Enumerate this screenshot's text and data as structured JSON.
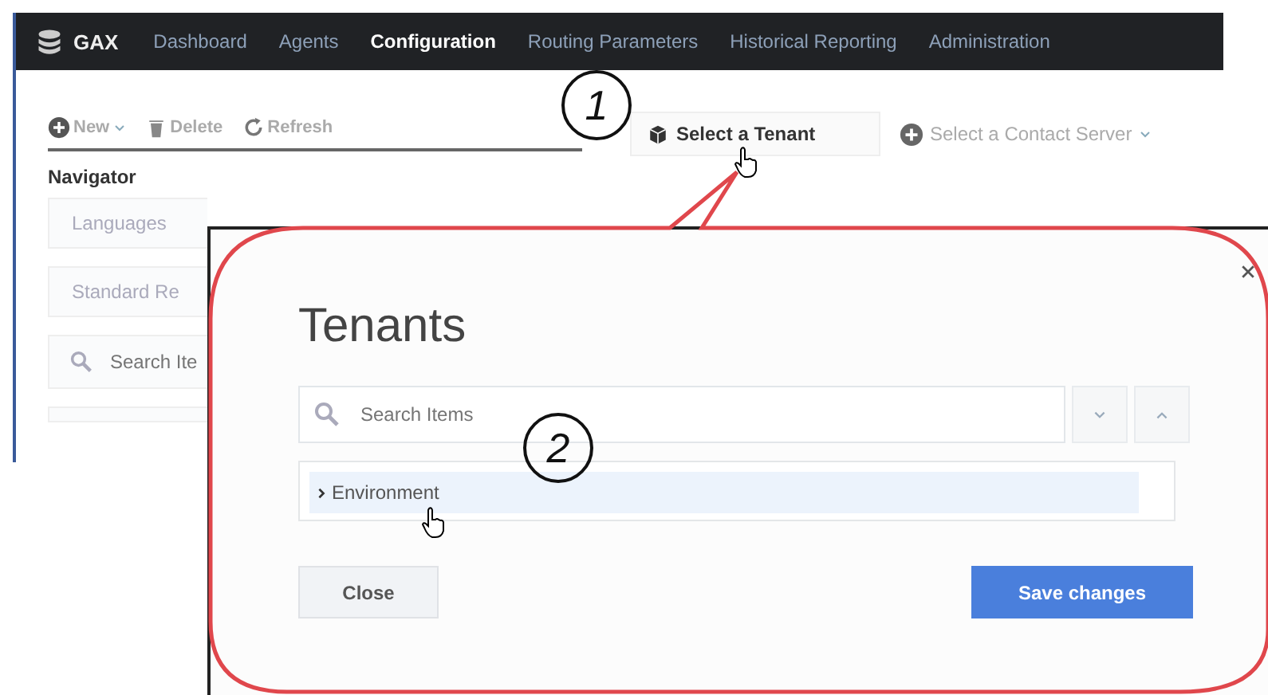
{
  "app": {
    "logo": "GAX",
    "nav": [
      {
        "label": "Dashboard",
        "selected": false
      },
      {
        "label": "Agents",
        "selected": false
      },
      {
        "label": "Configuration",
        "selected": true
      },
      {
        "label": "Routing Parameters",
        "selected": false
      },
      {
        "label": "Historical Reporting",
        "selected": false
      },
      {
        "label": "Administration",
        "selected": false
      }
    ],
    "toolbar": [
      {
        "kind": "new",
        "label": "New"
      },
      {
        "kind": "delete",
        "label": "Delete"
      },
      {
        "kind": "refresh",
        "label": "Refresh"
      }
    ],
    "tenant_button": "Select a Tenant",
    "contact_server": "Select a Contact Server",
    "navigator": {
      "title": "Navigator",
      "items": [
        "Languages",
        "Standard Re"
      ],
      "search_placeholder": "Search Ite"
    }
  },
  "dialog": {
    "title": "Tenants",
    "search": {
      "placeholder": "Search Items"
    },
    "tree": [
      {
        "label": "Environment",
        "expanded": false,
        "highlighted": true
      }
    ],
    "buttons": [
      {
        "label": "Close",
        "kind": "secondary"
      },
      {
        "label": "Save changes",
        "kind": "primary"
      }
    ]
  },
  "annotations": [
    {
      "label": "1"
    },
    {
      "label": "2"
    }
  ]
}
